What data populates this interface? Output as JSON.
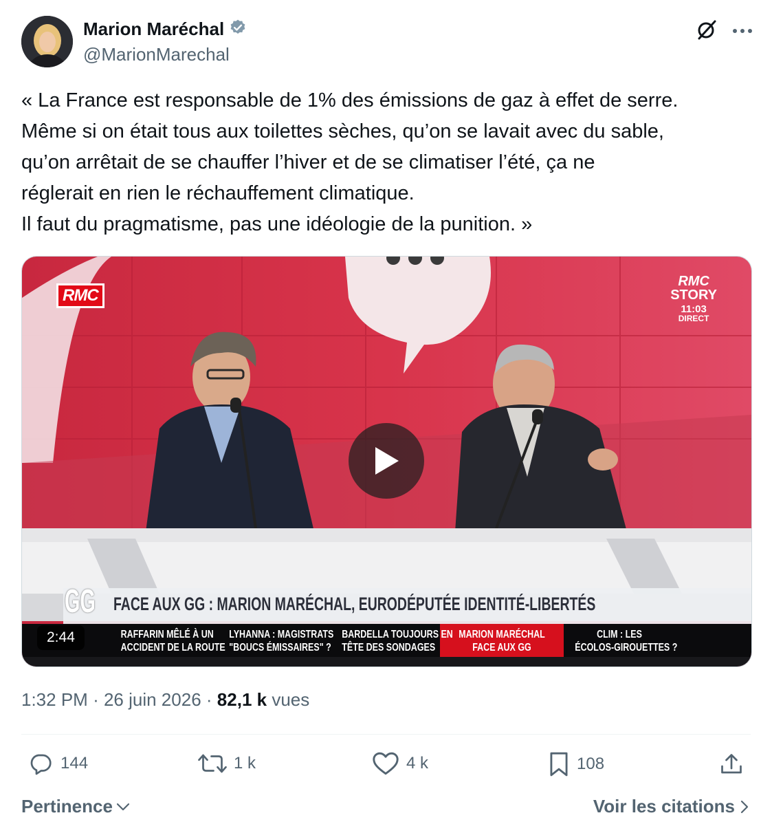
{
  "author": {
    "name": "Marion Maréchal",
    "handle": "@MarionMarechal",
    "verified": true
  },
  "tweet": {
    "text": "« La France est responsable de 1% des émissions de gaz à effet de serre.\nMême si on était tous aux toilettes sèches, qu’on se lavait avec du sable,\nqu’on arrêtait de se chauffer l’hiver et de se climatiser l’été, ça ne\nréglerait en rien le réchauffement climatique.\nIl faut du pragmatisme, pas une idéologie de la punition. »"
  },
  "video": {
    "duration": "2:44",
    "channel_logo": "RMC",
    "story_logo_1": "RMC",
    "story_logo_2": "STORY",
    "clock": "11:03",
    "live": "DIRECT",
    "show_logo": "GG",
    "banner": "FACE AUX GG : MARION MARÉCHAL, EURODÉPUTÉE IDENTITÉ-LIBERTÉS",
    "ticker": [
      {
        "line1": "RAFFARIN MÊLÉ À UN",
        "line2": "ACCIDENT DE LA ROUTE"
      },
      {
        "line1": "LYHANNA : MAGISTRATS",
        "line2": "\"BOUCS ÉMISSAIRES\" ?"
      },
      {
        "line1": "BARDELLA TOUJOURS EN",
        "line2": "TÊTE DES SONDAGES"
      },
      {
        "line1": "MARION MARÉCHAL",
        "line2": "FACE AUX GG"
      },
      {
        "line1": "CLIM : LES",
        "line2": "ÉCOLOS-GIROUETTES ?"
      }
    ]
  },
  "meta": {
    "time": "1:32 PM",
    "separator": "·",
    "date": "26 juin 2026",
    "views_count": "82,1 k",
    "views_label": "vues"
  },
  "actions": {
    "replies": "144",
    "reposts": "1 k",
    "likes": "4 k",
    "bookmarks": "108"
  },
  "footer": {
    "sort_label": "Pertinence",
    "quotes_label": "Voir les citations"
  },
  "colors": {
    "text": "#0f1419",
    "secondary": "#536471",
    "verified": "#829aab",
    "rmc_red": "#e20a17"
  }
}
